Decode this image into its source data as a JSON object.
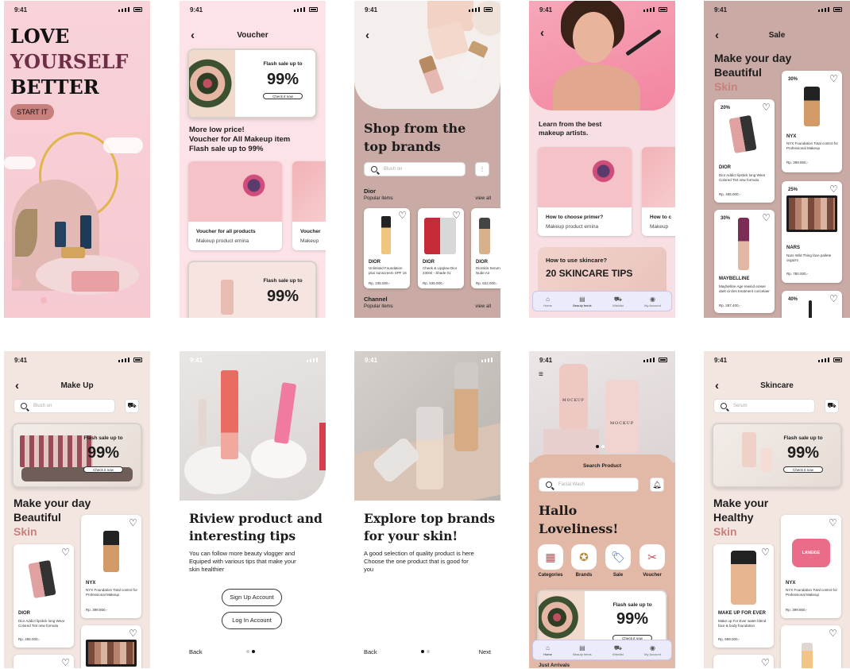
{
  "status_time": "9:41",
  "s1": {
    "line1": "LOVE",
    "line2": "YOURSELF",
    "line3": "BETTER",
    "start": "START IT"
  },
  "s2": {
    "title": "Voucher",
    "flash_label": "Flash sale up to",
    "flash_pct": "99%",
    "check": "Check it now",
    "headline1": "More low price!",
    "headline2": "Voucher for All Makeup item",
    "headline3": "Flash sale up to 99%",
    "card1_title": "Voucher for all products",
    "card1_sub": "Makeup product emina",
    "card2_title": "Voucher",
    "card2_sub": "Makeup",
    "flash2_label": "Flash sale up to",
    "flash2_pct": "99%"
  },
  "s3": {
    "heading1": "Shop from the",
    "heading2": "top brands",
    "search_placeholder": "Blush on",
    "sec1": "Dior",
    "sec1_sub": "Popular items",
    "view_all": "view all",
    "sec2": "Channel",
    "sec2_sub": "Popular items",
    "products": [
      {
        "brand": "DIOR",
        "desc": "Unlimited Foundation plus sunscreem SPF 15",
        "price": "Rp. 235.000,-"
      },
      {
        "brand": "DIOR",
        "desc": "Cheek & Lipglow Dior 230ml - Shade 01",
        "price": "Rp. 535.000,-"
      },
      {
        "brand": "DIOR",
        "desc": "Diorskin Serum Teint Nude Air",
        "price": "Rp. 622.000,-"
      }
    ]
  },
  "s4": {
    "intro1": "Learn from the best",
    "intro2": "makeup artists.",
    "card1_title": "How to choose primer?",
    "card1_sub": "Makeup product emina",
    "card2_title": "How to c",
    "card2_sub": "Makeup",
    "tip_q": "How to use skincare?",
    "tip_title": "20 SKINCARE TIPS"
  },
  "nav": [
    "Home",
    "Beauty feeds",
    "Wishlist",
    "My Account"
  ],
  "nav2": [
    "Home",
    "Beauty feeds",
    "Wishlist",
    "My Account"
  ],
  "s5": {
    "title": "Sale",
    "h1": "Make your day",
    "h2": "Beautiful",
    "h3": "Skin",
    "p1": {
      "pct": "20%",
      "brand": "DIOR",
      "desc": "Dior Addict lipstick long Wear Colored Tint new formula",
      "price": "Rp. 465.000,-"
    },
    "p2": {
      "pct": "30%",
      "brand": "NYX",
      "desc": "NYX Foundation Total control for Professional Makeup",
      "price": "Rp. 399.850,-"
    },
    "p3": {
      "pct": "30%",
      "brand": "MAYBELLINE",
      "desc": "Maybelline Age rewind eraser dark circles treatment concelaer",
      "price": "Rp. 287.400,-"
    },
    "p4": {
      "pct": "25%",
      "brand": "NARS",
      "desc": "Nars Wild Thing face pallete orgazm",
      "price": "Rp. 780.000,-"
    },
    "p5": {
      "pct": "40%"
    }
  },
  "s6": {
    "title": "Make Up",
    "search_placeholder": "Blush on",
    "flash_label": "Flash sale up to",
    "flash_pct": "99%",
    "check": "Check it now",
    "h1": "Make your day",
    "h2": "Beautiful",
    "h3": "Skin",
    "p1": {
      "brand": "DIOR",
      "desc": "Dior Addict lipstick long Wear Colored Tint new formula",
      "price": "Rp. 465.000,-"
    },
    "p2": {
      "brand": "NYX",
      "desc": "NYX Foundation Total control for Professional Makeup",
      "price": "Rp. 399.850,-"
    }
  },
  "s7": {
    "h1": "Riview product and",
    "h2": "interesting tips",
    "body1": "You can follow more beauty vlogger and",
    "body2": "Equiped with various tips that make your",
    "body3": "skin healthier",
    "signup": "Sign Up Account",
    "login": "Log In Account",
    "back": "Back"
  },
  "s8": {
    "h1": "Explore top brands",
    "h2": "for your skin!",
    "body1": "A good selection of quality product is here",
    "body2": "Choose the one product that is good for",
    "body3": "you",
    "back": "Back",
    "next": "Next"
  },
  "s9": {
    "search_label": "Search Product",
    "search_placeholder": "Facial Wash",
    "hello1": "Hallo",
    "hello2": "Loveliness!",
    "cats": [
      "Categories",
      "Brands",
      "Sale",
      "Voucher"
    ],
    "flash_label": "Flash sale up to",
    "flash_pct": "99%",
    "check": "Check it now",
    "just": "Just Arrivals",
    "mockup": "MOCKUP"
  },
  "s10": {
    "title": "Skincare",
    "search_placeholder": "Serum",
    "flash_label": "Flash sale up to",
    "flash_pct": "99%",
    "check": "Check it now",
    "h1": "Make your",
    "h2": "Healthy",
    "h3": "Skin",
    "p1": {
      "brand": "MAKE UP FOR EVER",
      "desc": "Make up For Ever water blend face & body foundation",
      "price": "Rp. 699.000,-"
    },
    "p2": {
      "brand": "NYX",
      "desc": "NYX Foundation Total control for Professional Makeup",
      "price": "Rp. 399.850,-"
    },
    "laneige": "LANEIGE"
  },
  "colors": {
    "pink_bg": "#f7cfd6",
    "voucher_bg": "#fde3e7",
    "taupe": "#c9aaa4",
    "cream": "#f3e6e1",
    "accent": "#c7807c",
    "plum": "#6d2f46"
  }
}
